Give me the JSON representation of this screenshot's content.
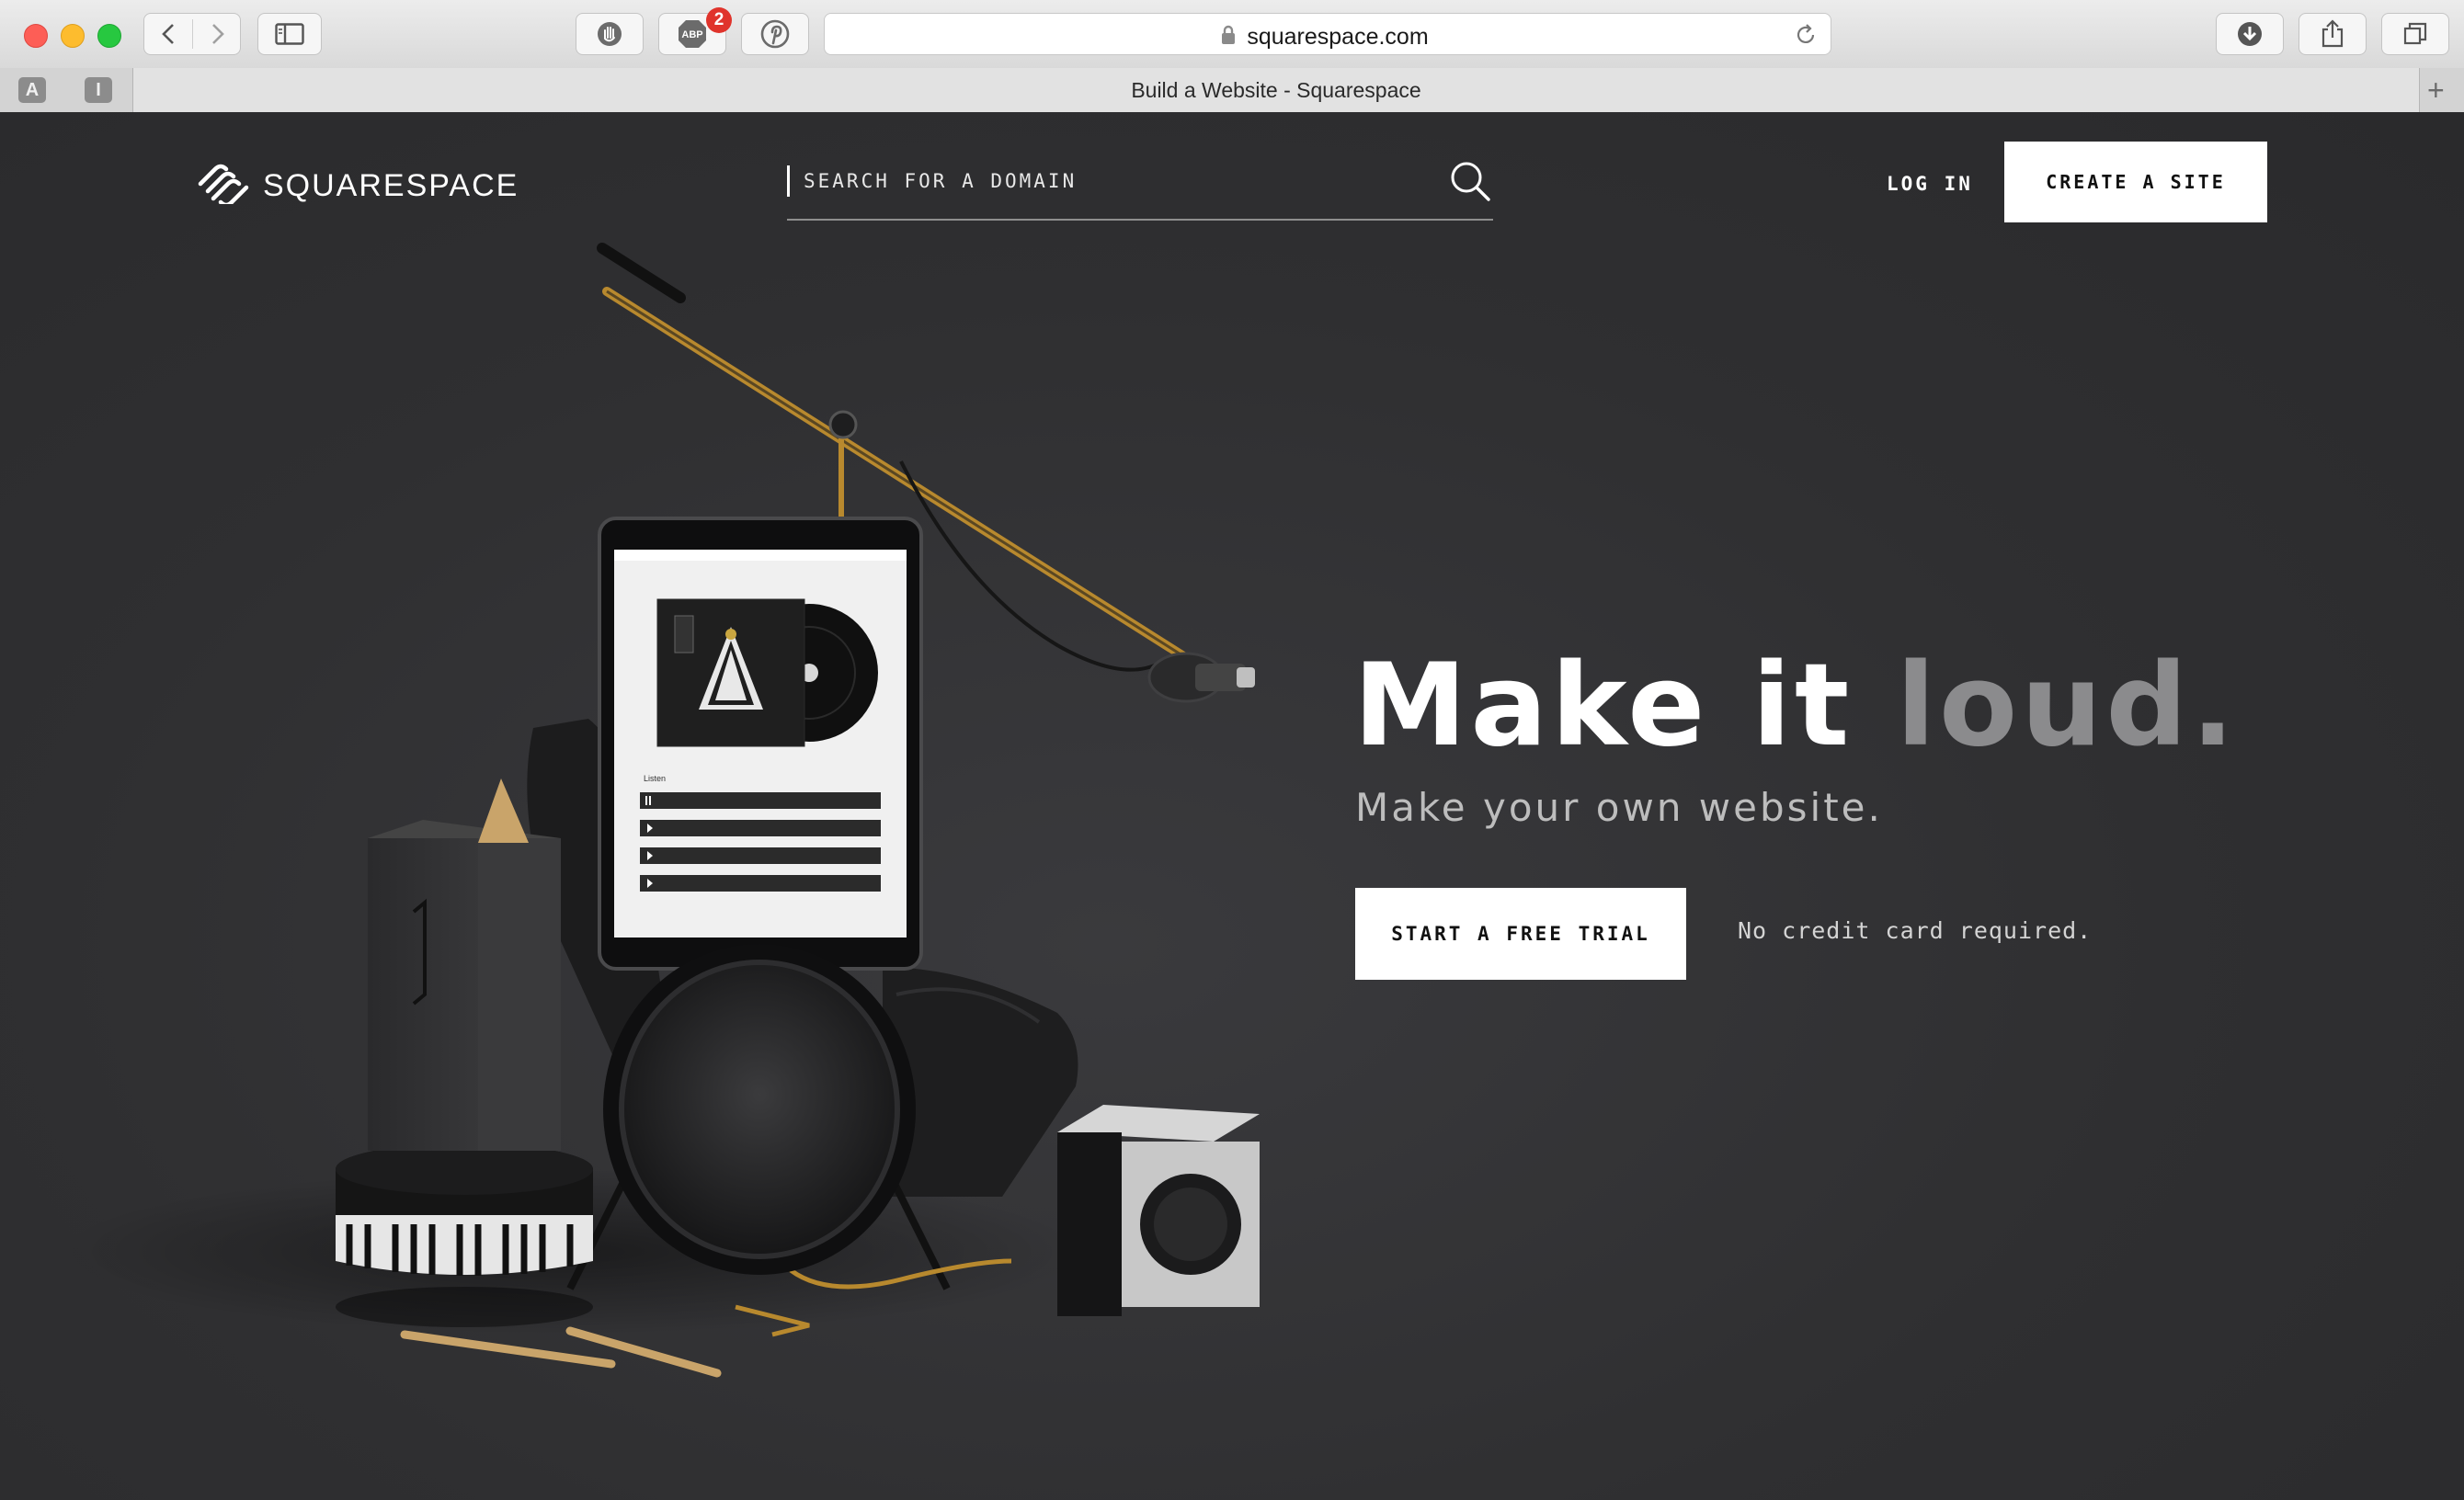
{
  "browser": {
    "url": "squarespace.com",
    "tab_title": "Build a Website - Squarespace",
    "adblock_badge": "2",
    "adblock_label": "ABP",
    "favorites": [
      "A",
      "I"
    ]
  },
  "header": {
    "logo_text": "SQUARESPACE",
    "search_placeholder": "SEARCH FOR A DOMAIN",
    "login_label": "LOG IN",
    "create_label": "CREATE A SITE"
  },
  "hero": {
    "headline_part1": "Make it ",
    "headline_part2": "loud.",
    "subheadline": "Make your own website.",
    "trial_label": "START A FREE TRIAL",
    "no_card": "No credit card required."
  },
  "tablet": {
    "section_label": "Listen"
  },
  "colors": {
    "background": "#2e2e30",
    "accent_gold": "#b8892e",
    "button_bg": "#ffffff"
  }
}
